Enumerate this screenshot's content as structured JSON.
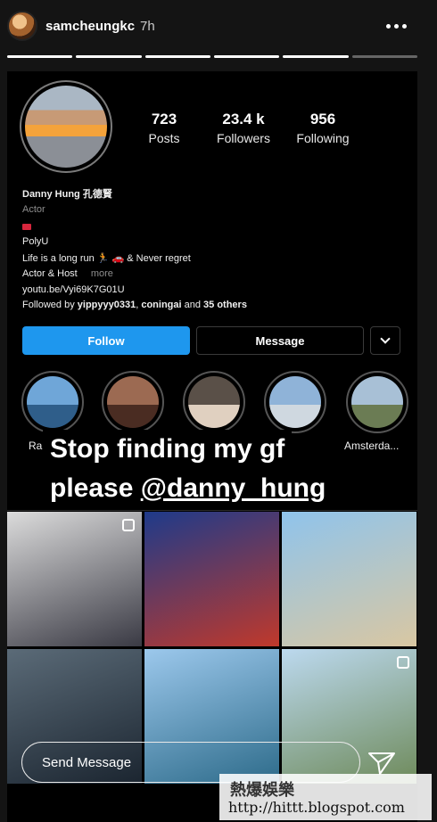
{
  "story": {
    "username": "samcheungkc",
    "time": "7h",
    "progress_segments": 6,
    "progress_completed": 5
  },
  "profile": {
    "stats": [
      {
        "value": "723",
        "label": "Posts"
      },
      {
        "value": "23.4 k",
        "label": "Followers"
      },
      {
        "value": "956",
        "label": "Following"
      }
    ],
    "name": "Danny Hung 孔德賢",
    "category": "Actor",
    "bio_lines": [
      "PolyU",
      "Life is a long run 🏃 🚗 & Never regret"
    ],
    "actor_host": "Actor & Host",
    "more": "more",
    "link": "youtu.be/Vyi69K7G01U",
    "followed_by_prefix": "Followed by ",
    "followed_by_names": "yippyyy0331",
    "followed_by_sep": ", ",
    "followed_by_names2": "coningai",
    "followed_by_and": " and ",
    "followed_by_others": "35 others"
  },
  "buttons": {
    "follow": "Follow",
    "message": "Message"
  },
  "highlights": [
    {
      "label": "Ra",
      "colors": [
        "#6fa6d8",
        "#2f5e8a"
      ]
    },
    {
      "label": "",
      "colors": [
        "#9c6a52",
        "#4a2c22"
      ]
    },
    {
      "label": "",
      "colors": [
        "#5a5048",
        "#e0d0c0"
      ]
    },
    {
      "label": "",
      "colors": [
        "#8fb3d8",
        "#cfd8e0"
      ]
    },
    {
      "label": "Amsterda...",
      "colors": [
        "#a8c0d6",
        "#6b7c54"
      ]
    }
  ],
  "caption": {
    "line1": "Stop finding my gf",
    "line2_prefix": "please ",
    "line2_mention": "@danny_hung"
  },
  "grid_tiles": [
    {
      "colors": [
        "#dcdcdc",
        "#3a3a44"
      ],
      "multi": true
    },
    {
      "colors": [
        "#1e3a8a",
        "#c0392b"
      ],
      "multi": false
    },
    {
      "colors": [
        "#8fc4ec",
        "#d9c7a2"
      ],
      "multi": false
    },
    {
      "colors": [
        "#5b6b78",
        "#1b2530"
      ],
      "multi": false
    },
    {
      "colors": [
        "#9cc8ec",
        "#2d6b8a"
      ],
      "multi": false
    },
    {
      "colors": [
        "#bcd9ef",
        "#6e8a5a"
      ],
      "multi": true
    }
  ],
  "message_bar": {
    "placeholder": "Send Message"
  },
  "watermark": {
    "chinese": "熱爆娛樂",
    "url": "http://hittt.blogspot.com"
  }
}
